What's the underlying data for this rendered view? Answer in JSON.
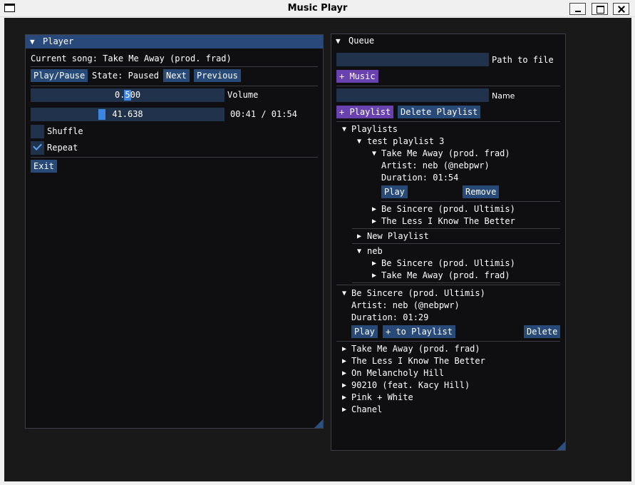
{
  "window": {
    "title": "Music Playr"
  },
  "player": {
    "title": "Player",
    "current_song_label": "Current song: Take Me Away (prod. frad)",
    "play_pause_label": "Play/Pause",
    "state_label": "State: Paused",
    "next_label": "Next",
    "previous_label": "Previous",
    "volume_value_text": "0.500",
    "volume_level": 0.5,
    "volume_label": "Volume",
    "position_value_text": "41.638",
    "position_fraction": 0.36,
    "time_text": "00:41 / 01:54",
    "shuffle_label": "Shuffle",
    "shuffle_checked": false,
    "repeat_label": "Repeat",
    "repeat_checked": true,
    "exit_label": "Exit"
  },
  "queue": {
    "title": "Queue",
    "path_input_value": "",
    "path_label": "Path to file",
    "add_music_label": "+ Music",
    "name_input_value": "",
    "name_label": "Name",
    "add_playlist_label": "+ Playlist",
    "delete_playlist_label": "Delete Playlist",
    "playlists_header": "Playlists",
    "playlists": [
      {
        "name": "test playlist 3",
        "expanded": true,
        "songs": [
          {
            "title": "Take Me Away (prod. frad)",
            "expanded": true,
            "artist": "Artist: neb (@nebpwr)",
            "duration": "Duration: 01:54",
            "play_label": "Play",
            "remove_label": "Remove"
          },
          {
            "title": "Be Sincere (prod. Ultimis)"
          },
          {
            "title": "The Less I Know The Better"
          }
        ]
      },
      {
        "name": "New Playlist",
        "expanded": false
      },
      {
        "name": "neb",
        "expanded": true,
        "songs": [
          {
            "title": "Be Sincere (prod. Ultimis)"
          },
          {
            "title": "Take Me Away (prod. frad)"
          }
        ]
      }
    ],
    "library": {
      "expanded_song": {
        "title": "Be Sincere (prod. Ultimis)",
        "artist": "Artist: neb (@nebpwr)",
        "duration": "Duration: 01:29",
        "play_label": "Play",
        "to_playlist_label": "+ to Playlist",
        "delete_label": "Delete"
      },
      "songs": [
        "Take Me Away (prod. frad)",
        "The Less I Know The Better",
        "On Melancholy Hill",
        "90210 (feat. Kacy Hill)",
        "Pink + White",
        "Chanel"
      ]
    }
  },
  "colors": {
    "header_active": "#29497a",
    "button": "#284a78",
    "button_purple": "#6a42b0",
    "frame_bg": "#20324c",
    "slider_grab": "#3d85e0",
    "window_bg": "#0f0f11"
  }
}
